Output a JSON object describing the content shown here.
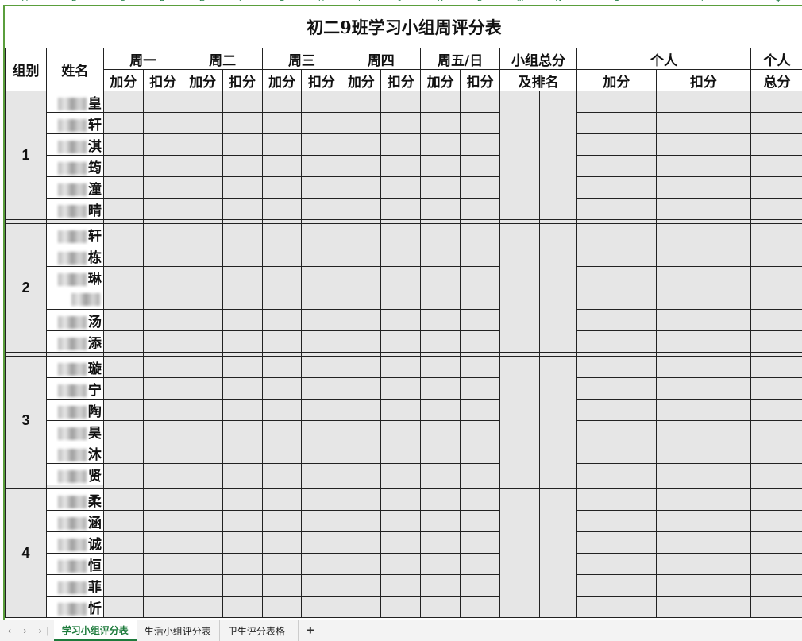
{
  "column_letters": [
    "A",
    "B",
    "C",
    "D",
    "E",
    "F",
    "G",
    "H",
    "I",
    "J",
    "K",
    "L",
    "M",
    "N",
    "O",
    "P",
    "Q"
  ],
  "title": "初二9班学习小组周评分表",
  "header": {
    "group": "组别",
    "name": "姓名",
    "days": [
      "周一",
      "周二",
      "周三",
      "周四",
      "周五/日"
    ],
    "add": "加分",
    "deduct": "扣分",
    "group_total_line1": "小组总分",
    "group_total_line2": "及排名",
    "individual": "个人",
    "ind_add": "加分",
    "ind_deduct": "扣分",
    "ind_total_line1": "个人",
    "ind_total_line2": "总分"
  },
  "groups": [
    {
      "id": "1",
      "members": [
        "皇",
        "轩",
        "淇",
        "筠",
        "潼",
        "晴"
      ]
    },
    {
      "id": "2",
      "members": [
        "轩",
        "栋",
        "琳",
        "",
        "汤",
        "添"
      ]
    },
    {
      "id": "3",
      "members": [
        "璇",
        "宁",
        "陶",
        "昊",
        "沐",
        "贤"
      ]
    },
    {
      "id": "4",
      "members": [
        "柔",
        "涵",
        "诚",
        "恒",
        "菲",
        "忻"
      ]
    }
  ],
  "tabs": {
    "nav": "‹ › ›|",
    "items": [
      "学习小组评分表",
      "生活小组评分表",
      "卫生评分表格"
    ],
    "add": "+"
  }
}
